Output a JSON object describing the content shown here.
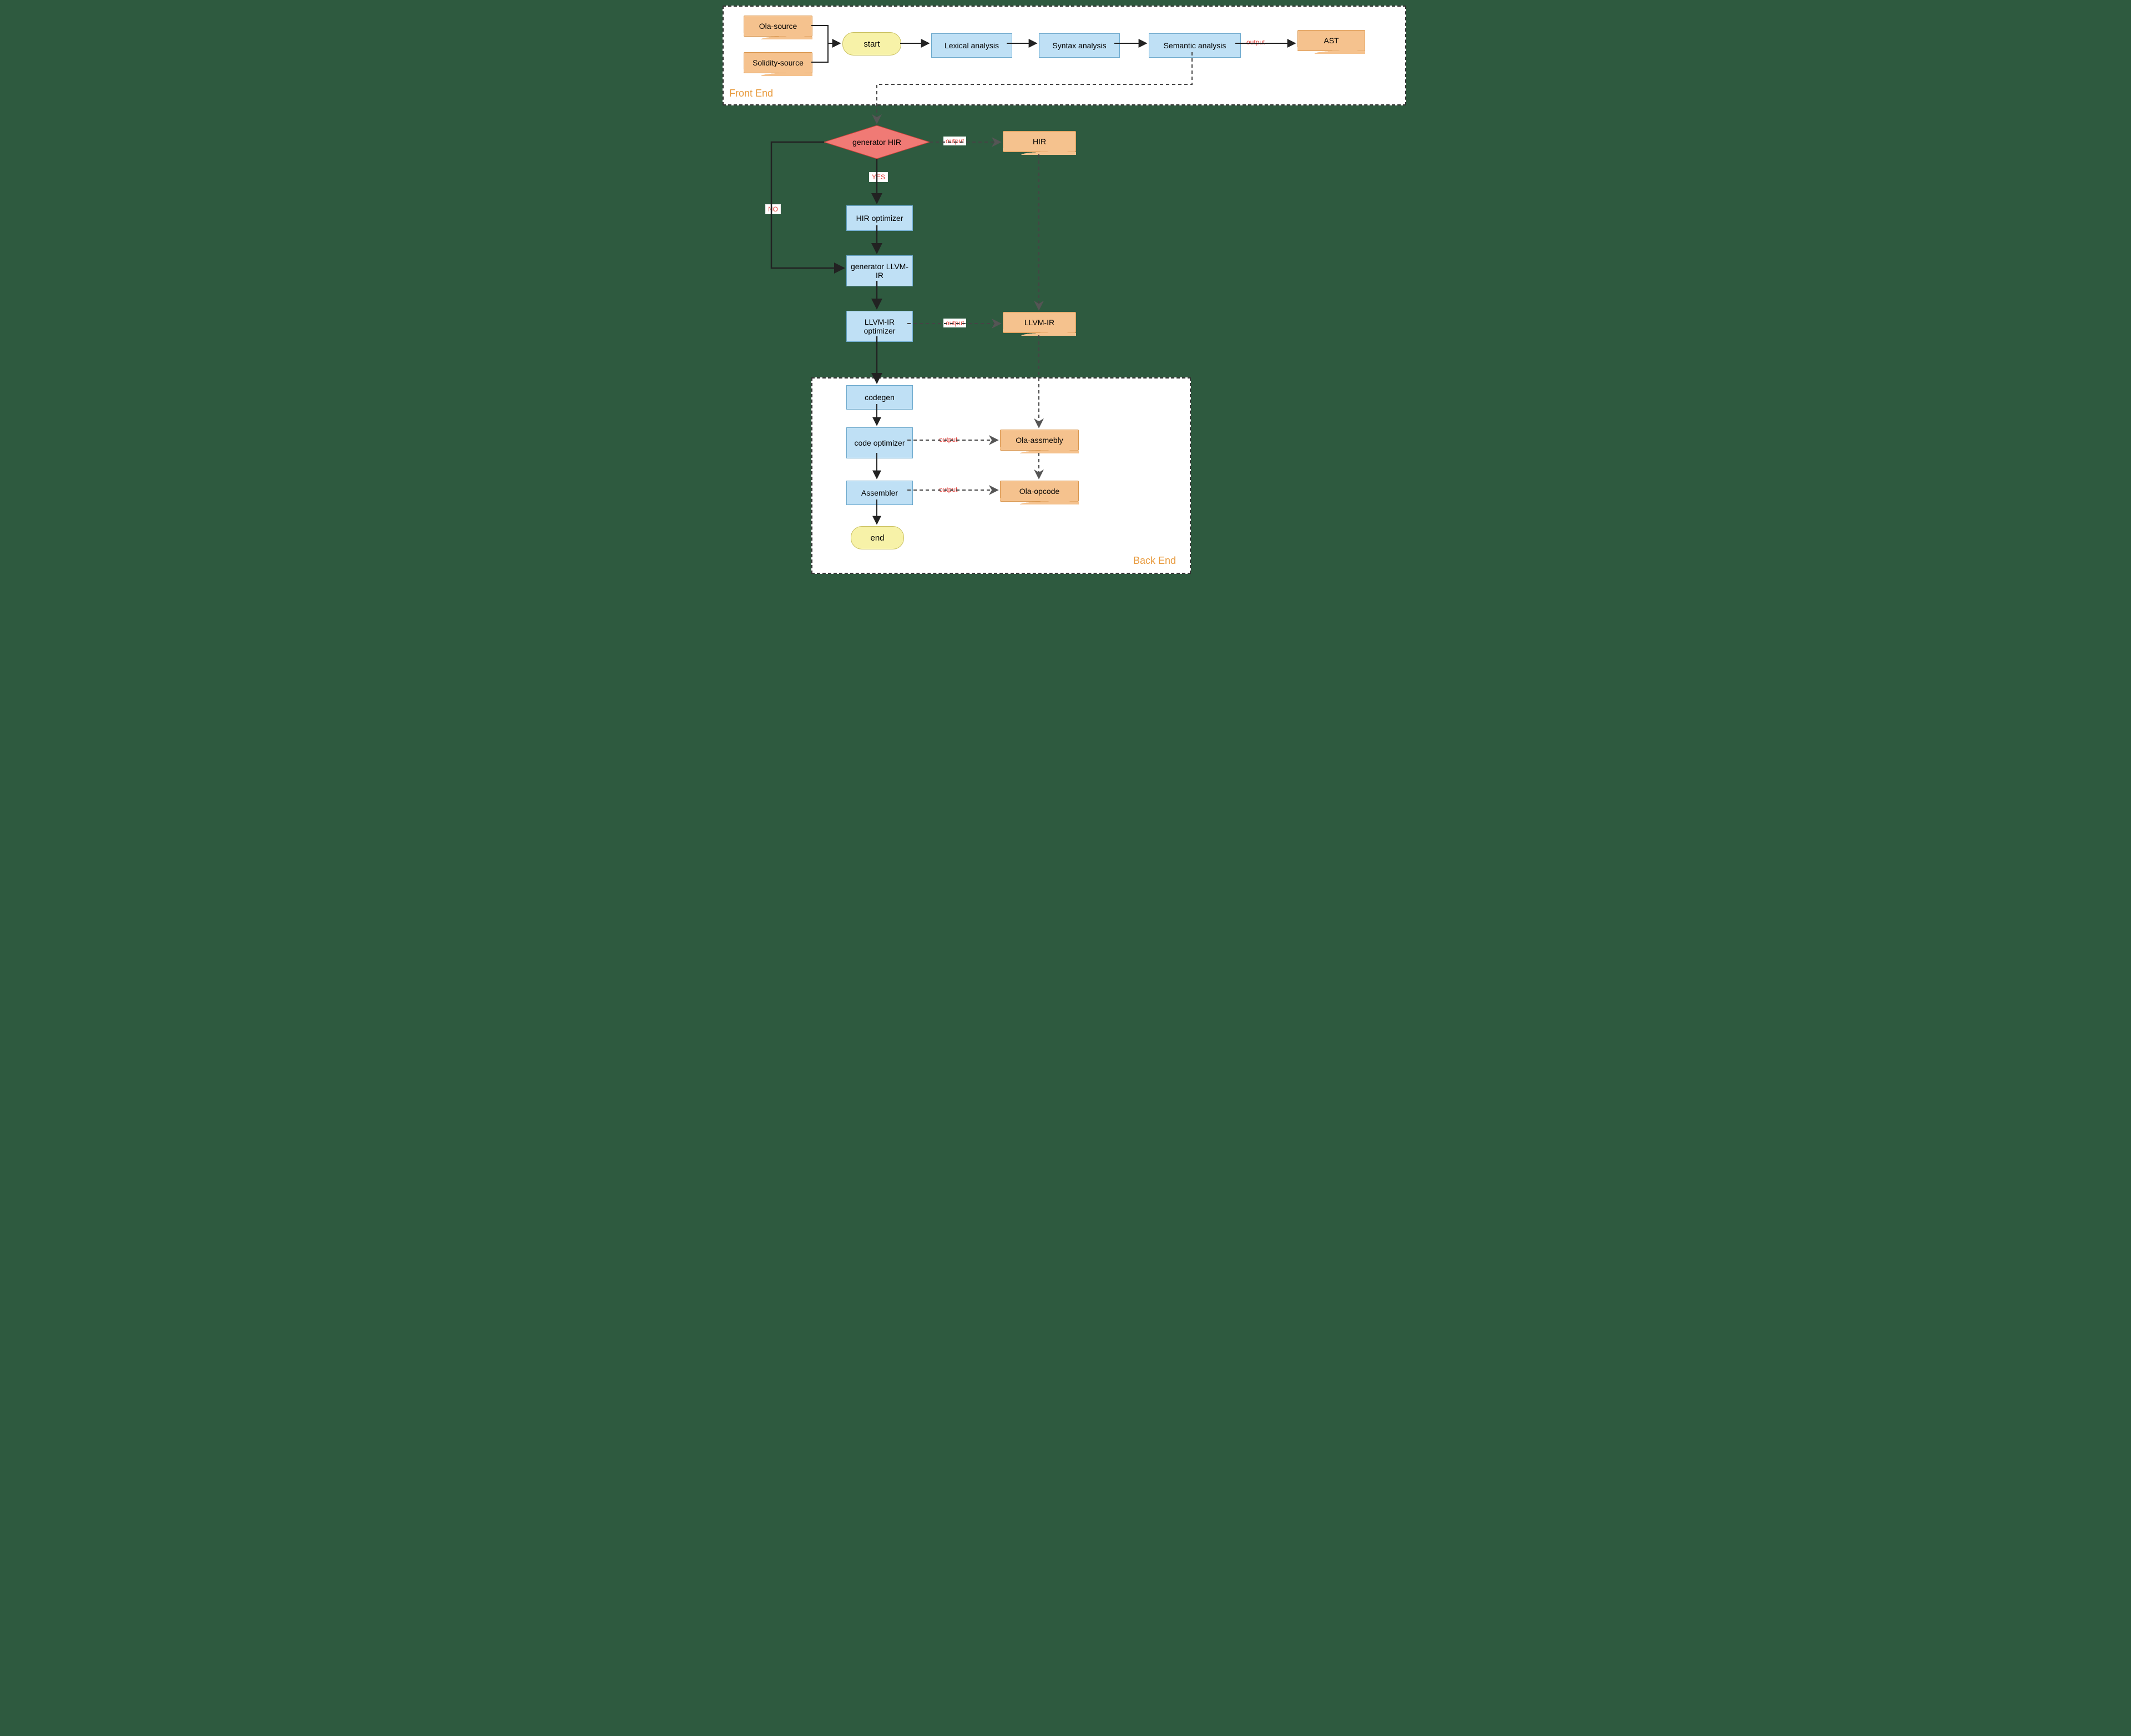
{
  "regions": {
    "front_end": "Front End",
    "back_end": "Back End"
  },
  "nodes": {
    "ola_source": "Ola-source",
    "solidity_source": "Solidity-source",
    "start": "start",
    "lexical": "Lexical analysis",
    "syntax": "Syntax analysis",
    "semantic": "Semantic analysis",
    "ast": "AST",
    "gen_hir": "generator HIR",
    "hir": "HIR",
    "hir_opt": "HIR optimizer",
    "gen_llvm": "generator LLVM-IR",
    "llvm_opt": "LLVM-IR optimizer",
    "llvm_ir": "LLVM-IR",
    "codegen": "codegen",
    "code_opt": "code optimizer",
    "ola_asm": "Ola-assmebly",
    "assembler": "Assembler",
    "ola_opcode": "Ola-opcode",
    "end": "end"
  },
  "edge_labels": {
    "output": "output",
    "yes": "YES",
    "no": "NO"
  },
  "chart_data": {
    "type": "flowchart",
    "regions": [
      {
        "id": "front_end",
        "label": "Front End",
        "contains": [
          "ola_source",
          "solidity_source",
          "start",
          "lexical",
          "syntax",
          "semantic",
          "ast"
        ]
      },
      {
        "id": "back_end",
        "label": "Back End",
        "contains": [
          "codegen",
          "code_opt",
          "assembler",
          "end",
          "ola_asm",
          "ola_opcode"
        ]
      }
    ],
    "nodes": [
      {
        "id": "ola_source",
        "shape": "document",
        "label": "Ola-source"
      },
      {
        "id": "solidity_source",
        "shape": "document",
        "label": "Solidity-source"
      },
      {
        "id": "start",
        "shape": "terminator",
        "label": "start"
      },
      {
        "id": "lexical",
        "shape": "process",
        "label": "Lexical analysis"
      },
      {
        "id": "syntax",
        "shape": "process",
        "label": "Syntax analysis"
      },
      {
        "id": "semantic",
        "shape": "process",
        "label": "Semantic analysis"
      },
      {
        "id": "ast",
        "shape": "document",
        "label": "AST"
      },
      {
        "id": "gen_hir",
        "shape": "decision",
        "label": "generator HIR"
      },
      {
        "id": "hir",
        "shape": "document",
        "label": "HIR"
      },
      {
        "id": "hir_opt",
        "shape": "process",
        "label": "HIR optimizer"
      },
      {
        "id": "gen_llvm",
        "shape": "process",
        "label": "generator LLVM-IR"
      },
      {
        "id": "llvm_opt",
        "shape": "process",
        "label": "LLVM-IR optimizer"
      },
      {
        "id": "llvm_ir",
        "shape": "document",
        "label": "LLVM-IR"
      },
      {
        "id": "codegen",
        "shape": "process",
        "label": "codegen"
      },
      {
        "id": "code_opt",
        "shape": "process",
        "label": "code optimizer"
      },
      {
        "id": "ola_asm",
        "shape": "document",
        "label": "Ola-assmebly"
      },
      {
        "id": "assembler",
        "shape": "process",
        "label": "Assembler"
      },
      {
        "id": "ola_opcode",
        "shape": "document",
        "label": "Ola-opcode"
      },
      {
        "id": "end",
        "shape": "terminator",
        "label": "end"
      }
    ],
    "edges": [
      {
        "from": "ola_source",
        "to": "start",
        "style": "solid"
      },
      {
        "from": "solidity_source",
        "to": "start",
        "style": "solid"
      },
      {
        "from": "start",
        "to": "lexical",
        "style": "solid"
      },
      {
        "from": "lexical",
        "to": "syntax",
        "style": "solid"
      },
      {
        "from": "syntax",
        "to": "semantic",
        "style": "solid"
      },
      {
        "from": "semantic",
        "to": "ast",
        "style": "solid",
        "label": "output"
      },
      {
        "from": "semantic",
        "to": "gen_hir",
        "style": "dashed"
      },
      {
        "from": "gen_hir",
        "to": "hir",
        "style": "dashed",
        "label": "output"
      },
      {
        "from": "gen_hir",
        "to": "hir_opt",
        "style": "solid",
        "label": "YES"
      },
      {
        "from": "gen_hir",
        "to": "gen_llvm",
        "style": "solid",
        "label": "NO"
      },
      {
        "from": "hir_opt",
        "to": "gen_llvm",
        "style": "solid"
      },
      {
        "from": "gen_llvm",
        "to": "llvm_opt",
        "style": "solid"
      },
      {
        "from": "llvm_opt",
        "to": "llvm_ir",
        "style": "dashed",
        "label": "output"
      },
      {
        "from": "hir",
        "to": "llvm_ir",
        "style": "dashed"
      },
      {
        "from": "llvm_opt",
        "to": "codegen",
        "style": "solid"
      },
      {
        "from": "codegen",
        "to": "code_opt",
        "style": "solid"
      },
      {
        "from": "code_opt",
        "to": "ola_asm",
        "style": "dashed",
        "label": "output"
      },
      {
        "from": "code_opt",
        "to": "assembler",
        "style": "solid"
      },
      {
        "from": "assembler",
        "to": "ola_opcode",
        "style": "dashed",
        "label": "output"
      },
      {
        "from": "llvm_ir",
        "to": "ola_asm",
        "style": "dashed"
      },
      {
        "from": "ola_asm",
        "to": "ola_opcode",
        "style": "dashed"
      },
      {
        "from": "assembler",
        "to": "end",
        "style": "solid"
      }
    ]
  }
}
